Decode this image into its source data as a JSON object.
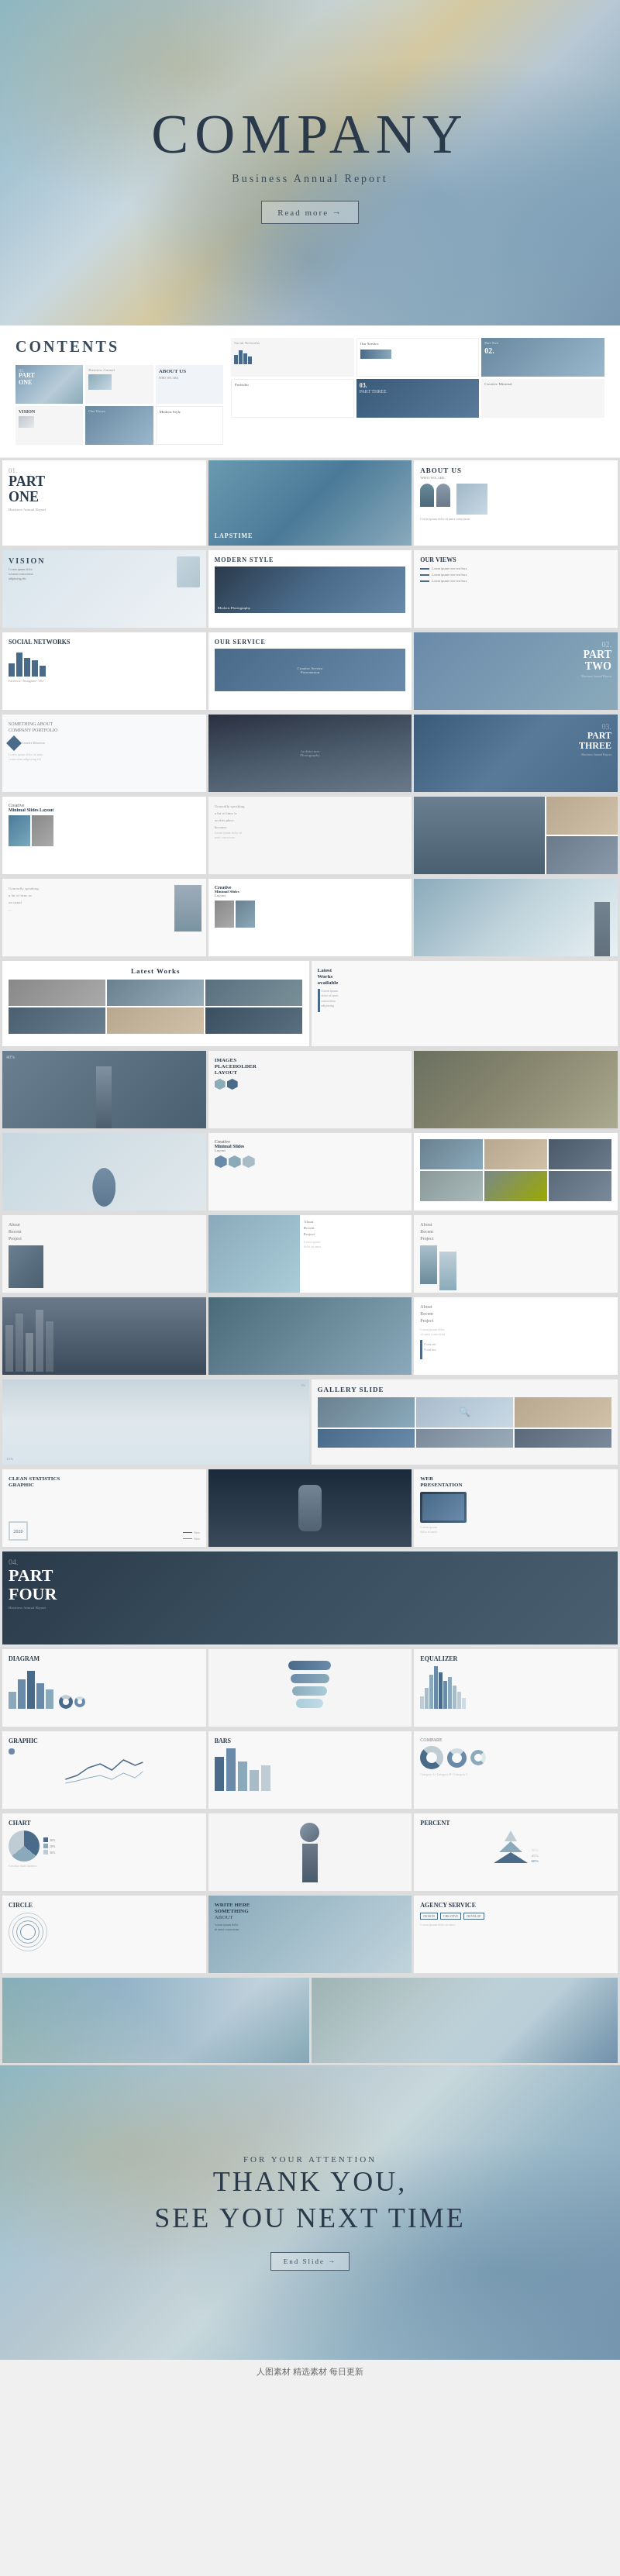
{
  "hero": {
    "title": "COMPANY",
    "subtitle": "Business Annual Report",
    "btn_label": "Read more →"
  },
  "contents": {
    "label": "CONTENTS",
    "parts": [
      {
        "number": "01.",
        "title": "PART ONE",
        "subtitle": "Business Annual Report"
      },
      {
        "number": "02.",
        "title": "PART TWO"
      },
      {
        "number": "03.",
        "title": "PART THREE"
      },
      {
        "number": "04.",
        "title": "PART FOUR"
      }
    ]
  },
  "slides": {
    "about_us": "ABOUT US",
    "who_we_are": "WHO WE ARE",
    "vision": "VISION",
    "our_views": "OUR VIEWS",
    "modern_style": "MODERN STYLE",
    "our_service": "OUR SERVICE",
    "social_networks": "SOCIAL NETWORKS",
    "part_two": "TWo",
    "part_three": "PART THREE",
    "part_four": "PART FOUR",
    "portfolio": "SOMETHING ABOUT COMPANY PORTFOLIO",
    "creative_minimal": "Creative Minimal Slides Layout",
    "latest_works": "Latest Works",
    "images_placeholder": "IMAGES PLACEHOLDER LAYOUT",
    "gallery_slide": "GALLERY SLIDE",
    "clean_statistics": "CLEAN STATISTICS GRAPHIC",
    "web_presentation": "WEB PRESENTATION",
    "diagram": "DIAGRAM",
    "equalizer": "EQUALIZER",
    "graphic": "GRAPHIC",
    "bars": "BARS",
    "chart": "CHART",
    "circle": "CIRCLE",
    "percent": "PERCENT",
    "write_here": "WRITE HERE SOMETHING ABOUT",
    "agency_service": "AGENCY SERVICE",
    "thank_you_line1": "THANK YOU,",
    "thank_you_line2": "SEE YOU NEXT TIME",
    "for_attention": "FOR YOUR ATTENTION",
    "end_slide": "End Slide →"
  },
  "watermark": {
    "text": "人图素材   精选素材   每日更新"
  }
}
